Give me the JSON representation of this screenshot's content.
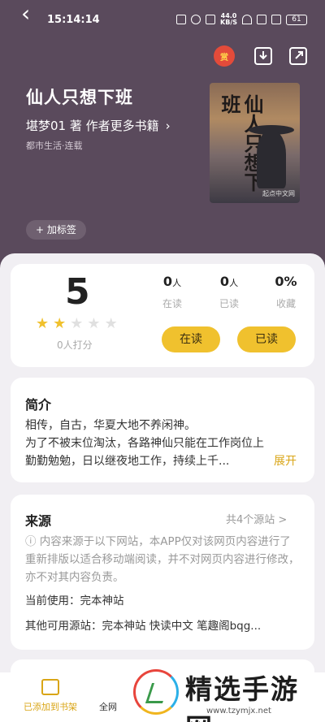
{
  "status": {
    "time": "15:14:14",
    "net_speed": "44.0\nKB/S",
    "battery": "61"
  },
  "nav": {
    "back_icon": "chevron-left-icon",
    "red_bag_label": "赏",
    "download_icon": "download-icon",
    "share_icon": "share-icon"
  },
  "book": {
    "title": "仙人只想下班",
    "author_line": "堪梦01  著  作者更多书籍",
    "category": "都市生活·连载",
    "cover_text": "仙人只想下班",
    "cover_mark": "起点中文网",
    "add_tag": "+ 加标签"
  },
  "stats": {
    "score": "5",
    "stars_on": 2,
    "stars_total": 5,
    "raters": "0人打分",
    "reading_num": "0",
    "reading_unit": "人",
    "reading_label": "在读",
    "read_num": "0",
    "read_unit": "人",
    "read_label": "已读",
    "fav_num": "0%",
    "fav_label": "收藏",
    "btn_reading": "在读",
    "btn_read": "已读"
  },
  "intro": {
    "title": "简介",
    "lines": [
      "相传，自古，华夏大地不养闲神。",
      "为了不被末位淘汰，各路神仙只能在工作岗位上",
      "勤勤勉勉，日以继夜地工作，持续上千..."
    ],
    "expand": "展开"
  },
  "source": {
    "title": "来源",
    "count": "共4个源站 >",
    "note": "ⓘ 内容来源于以下网站，本APP仅对该网页内容进行了重新排版以适合移动端阅读，并不对网页内容进行修改，亦不对其内容负责。",
    "current": "当前使用：完本神站",
    "others": "其他可用源站：完本神站  快读中文  笔趣阁bqg..."
  },
  "bottom": {
    "shelf_label": "已添加到书架",
    "all_net": "全网",
    "watermark_title": "精选手游网",
    "watermark_url": "www.tzymjx.net"
  }
}
